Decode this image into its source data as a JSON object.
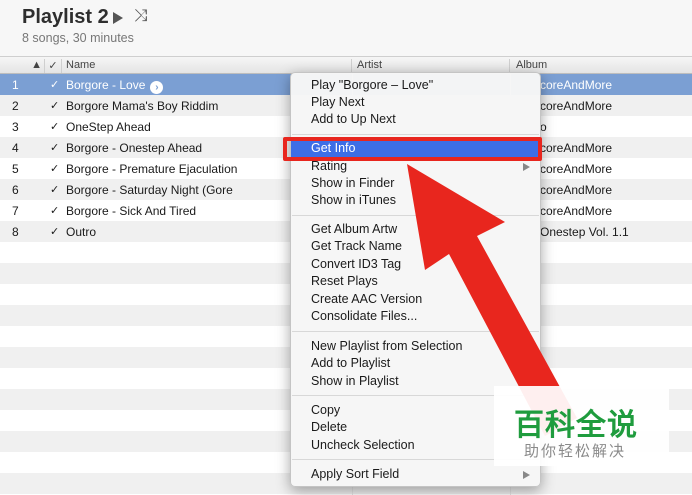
{
  "playlist": {
    "title": "Playlist 2",
    "subtitle": "8 songs, 30 minutes",
    "play_icon": "play-icon",
    "shuffle_icon": "shuffle-icon",
    "shuffle_glyph": "⤨"
  },
  "columns": {
    "sort_arrow": "▲",
    "check": "✓",
    "name": "Name",
    "artist": "Artist",
    "album": "Album"
  },
  "tracks": [
    {
      "num": "1",
      "check": "✓",
      "name": "Borgore - Love",
      "album": "coreAndMore",
      "arrow": "›"
    },
    {
      "num": "2",
      "check": "✓",
      "name": "Borgore   Mama's Boy Riddim",
      "album": "coreAndMore"
    },
    {
      "num": "3",
      "check": "✓",
      "name": "OneStep Ahead",
      "album": "o"
    },
    {
      "num": "4",
      "check": "✓",
      "name": "Borgore - Onestep Ahead",
      "album": "coreAndMore"
    },
    {
      "num": "5",
      "check": "✓",
      "name": "Borgore - Premature Ejaculation",
      "album": "coreAndMore"
    },
    {
      "num": "6",
      "check": "✓",
      "name": "Borgore - Saturday Night (Gore",
      "album": "coreAndMore"
    },
    {
      "num": "7",
      "check": "✓",
      "name": "Borgore - Sick And Tired",
      "album": "coreAndMore"
    },
    {
      "num": "8",
      "check": "✓",
      "name": "Outro",
      "album": "Onestep Vol. 1.1"
    }
  ],
  "context_menu": {
    "items": [
      "Play \"Borgore – Love\"",
      "Play Next",
      "Add to Up Next",
      "Get Info",
      "Rating",
      "Show in Finder",
      "Show in iTunes",
      "Get Album Artw",
      "Get Track Name",
      "Convert ID3 Tag",
      "Reset Plays",
      "Create AAC Version",
      "Consolidate Files...",
      "New Playlist from Selection",
      "Add to Playlist",
      "Show in Playlist",
      "Copy",
      "Delete",
      "Uncheck Selection",
      "Apply Sort Field"
    ],
    "new_playlist_shortcut": "⇧⌘",
    "highlighted_item": "Get Info"
  },
  "watermark": {
    "title": "百科全说",
    "subtitle": "助你轻松解决"
  },
  "colors": {
    "selection_row": "#7b9fd3",
    "menu_highlight": "#3d6ee6",
    "annotation_red": "#e8261e",
    "watermark_green": "#1f9c3e"
  }
}
